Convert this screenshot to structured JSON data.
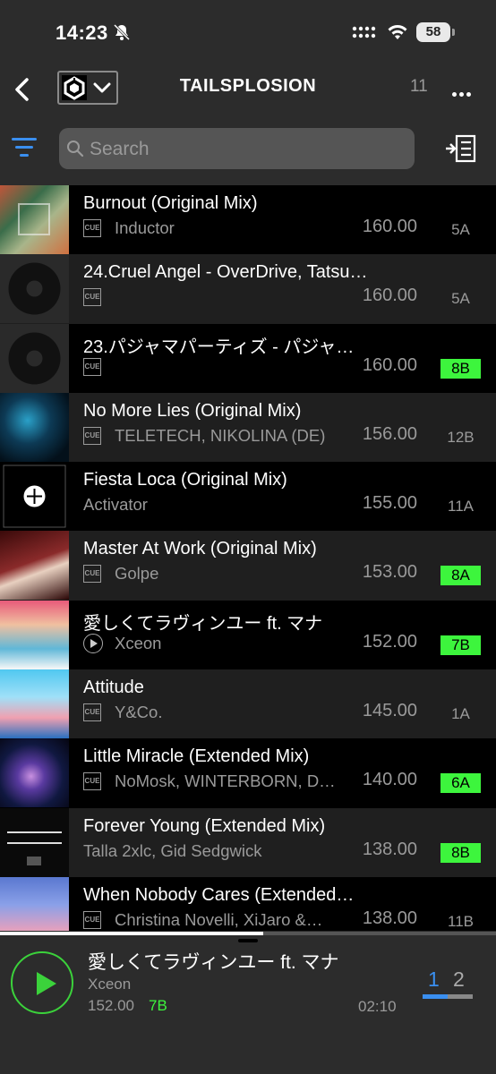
{
  "status_bar": {
    "time": "14:23",
    "battery": "58"
  },
  "nav": {
    "title": "TAILSPLOSION",
    "count": "11"
  },
  "search": {
    "placeholder": "Search"
  },
  "colors": {
    "key_highlight": "#3df53d",
    "accent_blue": "#3a8ff0",
    "play_green": "#3bd23b"
  },
  "tracks": [
    {
      "title": "Burnout (Original Mix)",
      "cue": "CUE",
      "artist": "Inductor",
      "bpm": "160.00",
      "key": "5A",
      "key_highlight": false
    },
    {
      "title": "24.Cruel Angel - OverDrive, Tatsu…",
      "cue": "CUE",
      "artist": "",
      "bpm": "160.00",
      "key": "5A",
      "key_highlight": false
    },
    {
      "title": "23.パジャマパーティズ - パジャ…",
      "cue": "CUE",
      "artist": "",
      "bpm": "160.00",
      "key": "8B",
      "key_highlight": true
    },
    {
      "title": "No More Lies (Original Mix)",
      "cue": "CUE",
      "artist": "TELETECH, NIKOLINA (DE)",
      "bpm": "156.00",
      "key": "12B",
      "key_highlight": false
    },
    {
      "title": "Fiesta Loca (Original Mix)",
      "cue": "",
      "artist": "Activator",
      "bpm": "155.00",
      "key": "11A",
      "key_highlight": false
    },
    {
      "title": "Master At Work (Original Mix)",
      "cue": "CUE",
      "artist": "Golpe",
      "bpm": "153.00",
      "key": "8A",
      "key_highlight": true
    },
    {
      "title": "愛しくてラヴィンユー ft. マナ",
      "cue": "play",
      "artist": "Xceon",
      "bpm": "152.00",
      "key": "7B",
      "key_highlight": true
    },
    {
      "title": "Attitude",
      "cue": "CUE",
      "artist": "Y&Co.",
      "bpm": "145.00",
      "key": "1A",
      "key_highlight": false
    },
    {
      "title": "Little Miracle (Extended Mix)",
      "cue": "CUE",
      "artist": "NoMosk, WINTERBORN, D…",
      "bpm": "140.00",
      "key": "6A",
      "key_highlight": true
    },
    {
      "title": "Forever Young (Extended Mix)",
      "cue": "",
      "artist": "Talla 2xlc, Gid Sedgwick",
      "bpm": "138.00",
      "key": "8B",
      "key_highlight": true
    },
    {
      "title": "When Nobody Cares (Extended…",
      "cue": "CUE",
      "artist": "Christina Novelli, XiJaro &…",
      "bpm": "138.00",
      "key": "11B",
      "key_highlight": false
    }
  ],
  "player": {
    "title": "愛しくてラヴィンユー ft. マナ",
    "artist": "Xceon",
    "bpm": "152.00",
    "key": "7B",
    "time": "02:10",
    "deck1": "1",
    "deck2": "2",
    "progress_fraction": 0.53
  }
}
